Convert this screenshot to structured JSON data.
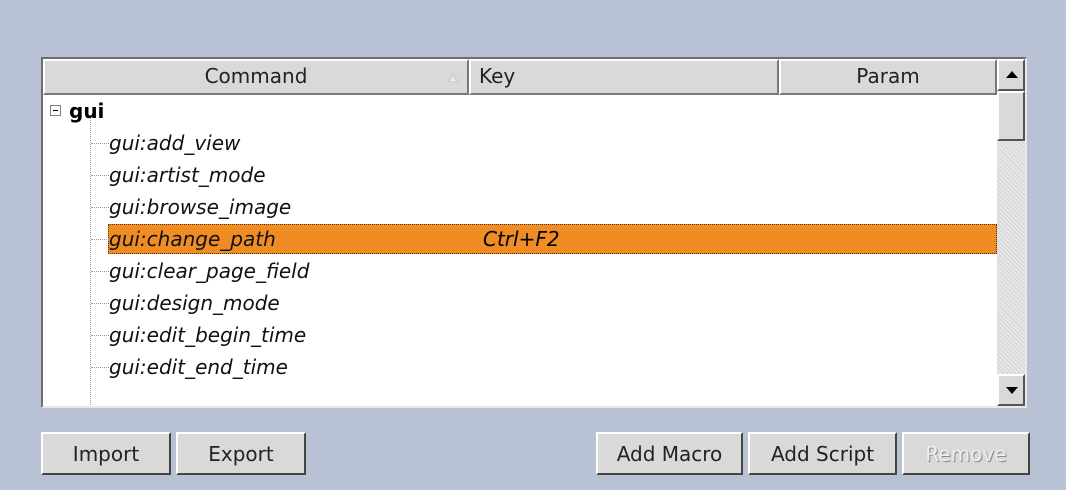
{
  "table": {
    "columns": {
      "command": "Command",
      "key": "Key",
      "param": "Param"
    },
    "group": {
      "label": "gui",
      "expanded": true
    },
    "rows": [
      {
        "command": "gui:add_view",
        "key": "",
        "param": ""
      },
      {
        "command": "gui:artist_mode",
        "key": "",
        "param": ""
      },
      {
        "command": "gui:browse_image",
        "key": "",
        "param": ""
      },
      {
        "command": "gui:change_path",
        "key": "Ctrl+F2",
        "param": "",
        "selected": true
      },
      {
        "command": "gui:clear_page_field",
        "key": "",
        "param": ""
      },
      {
        "command": "gui:design_mode",
        "key": "",
        "param": ""
      },
      {
        "command": "gui:edit_begin_time",
        "key": "",
        "param": ""
      },
      {
        "command": "gui:edit_end_time",
        "key": "",
        "param": ""
      }
    ],
    "sort": {
      "column": "Command",
      "direction": "ascending"
    }
  },
  "buttons": {
    "import": "Import",
    "export": "Export",
    "add_macro": "Add Macro",
    "add_script": "Add Script",
    "remove": "Remove"
  },
  "colors": {
    "background": "#b9c2d4",
    "selection": "#f08c24",
    "button_face": "#d9d9d9"
  }
}
